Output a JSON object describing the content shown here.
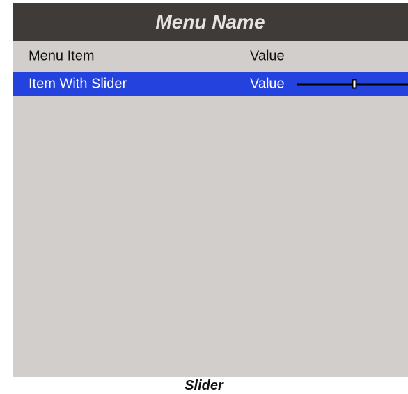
{
  "menu": {
    "title": "Menu Name",
    "items": [
      {
        "label": "Menu Item",
        "value": "Value"
      },
      {
        "label": "Item With Slider",
        "value": "Value",
        "slider_level": 0.52
      }
    ]
  },
  "caption": "Slider",
  "colors": {
    "header_bg": "#3e3b38",
    "panel_bg": "#d1cecb",
    "selected_row_bg": "#2442de",
    "header_text": "#e6e4e1"
  }
}
